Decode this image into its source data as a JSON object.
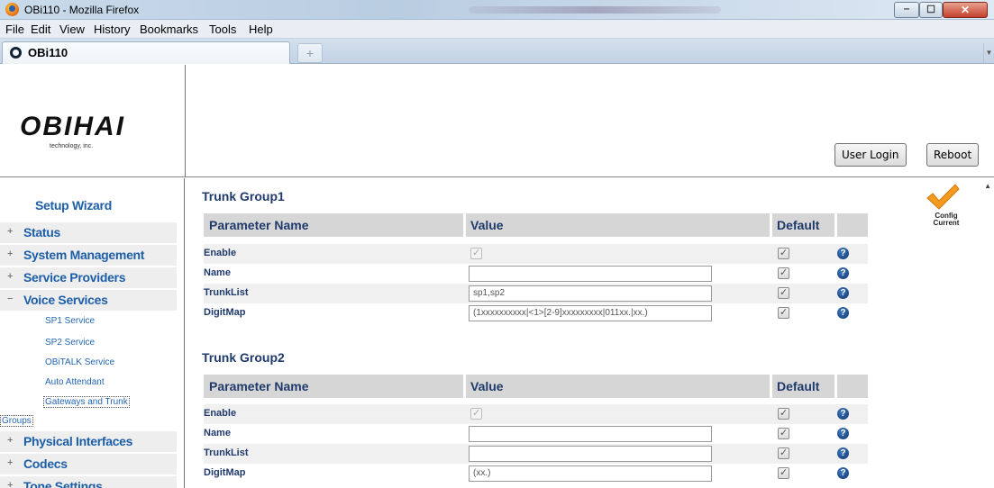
{
  "window": {
    "title": "OBi110 - Mozilla Firefox",
    "controls": {
      "minimize": "‒",
      "maximize": "☐",
      "close": "✕"
    }
  },
  "menu": [
    "File",
    "Edit",
    "View",
    "History",
    "Bookmarks",
    "Tools",
    "Help"
  ],
  "tabs": {
    "active_label": "OBi110",
    "new_tab": "+"
  },
  "header": {
    "logo": "OBIHAI",
    "logo_sub": "technology, inc.",
    "user_login": "User Login",
    "reboot": "Reboot"
  },
  "sidebar": {
    "wizard": "Setup Wizard",
    "groups": [
      {
        "sign": "+",
        "label": "Status"
      },
      {
        "sign": "+",
        "label": "System Management"
      },
      {
        "sign": "+",
        "label": "Service Providers"
      },
      {
        "sign": "−",
        "label": "Voice Services"
      }
    ],
    "voice_items": [
      "SP1 Service",
      "SP2 Service",
      "OBiTALK Service",
      "Auto Attendant",
      "Gateways and Trunk"
    ],
    "voice_items_wrap": "Groups",
    "groups_after": [
      {
        "sign": "+",
        "label": "Physical Interfaces"
      },
      {
        "sign": "+",
        "label": "Codecs"
      },
      {
        "sign": "+",
        "label": "Tone Settings"
      }
    ]
  },
  "main": {
    "table_headers": {
      "param": "Parameter Name",
      "value": "Value",
      "default": "Default"
    },
    "trunk_groups": [
      {
        "title": "Trunk Group1",
        "rows": [
          {
            "name": "Enable",
            "type": "checkbox",
            "value": ""
          },
          {
            "name": "Name",
            "type": "text",
            "value": ""
          },
          {
            "name": "TrunkList",
            "type": "text",
            "value": "sp1,sp2"
          },
          {
            "name": "DigitMap",
            "type": "text",
            "value": "(1xxxxxxxxxx|<1>[2-9]xxxxxxxxx|011xx.|xx.)"
          }
        ]
      },
      {
        "title": "Trunk Group2",
        "rows": [
          {
            "name": "Enable",
            "type": "checkbox",
            "value": ""
          },
          {
            "name": "Name",
            "type": "text",
            "value": ""
          },
          {
            "name": "TrunkList",
            "type": "text",
            "value": ""
          },
          {
            "name": "DigitMap",
            "type": "text",
            "value": "(xx.)"
          }
        ]
      }
    ],
    "help_glyph": "?",
    "config_status": "Config Current"
  }
}
